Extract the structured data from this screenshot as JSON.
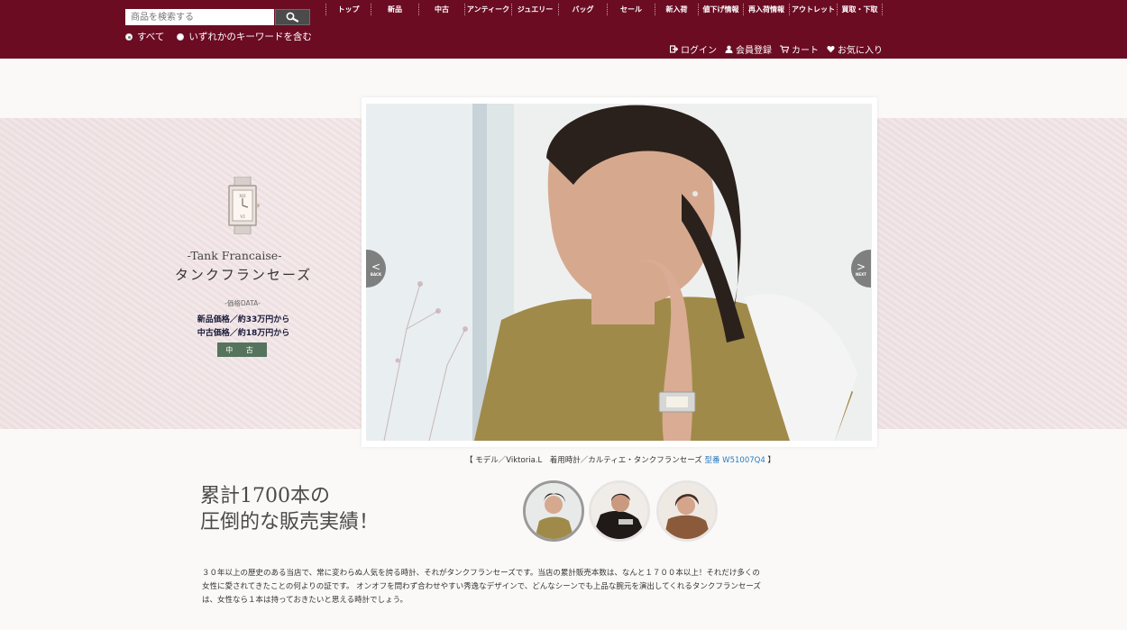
{
  "header": {
    "search_placeholder": "商品を検索する",
    "radio_all": "すべて",
    "radio_any": "いずれかのキーワードを含む",
    "nav": [
      "トップ",
      "新品",
      "中古",
      "アンティーク",
      "ジュエリー",
      "バッグ",
      "セール",
      "新入荷",
      "値下げ情報",
      "再入荷情報",
      "アウトレット",
      "買取・下取"
    ],
    "account": {
      "login": "ログイン",
      "register": "会員登録",
      "cart": "カート",
      "favorites": "お気に入り"
    }
  },
  "hero": {
    "model_en": "-Tank Francaise-",
    "model_jp": "タンクフランセーズ",
    "price_title": "-価格DATA-",
    "price_new": "新品価格／約33万円から",
    "price_used": "中古価格／約18万円から",
    "used_button": "中 古",
    "back_label": "BACK",
    "next_label": "NEXT",
    "back_chev": "<",
    "next_chev": ">"
  },
  "caption": {
    "prefix": "【 モデル／Viktoria.L　着用時計／カルティエ・タンクフランセーズ ",
    "model_no": "型番 W51007Q4",
    "suffix": " 】"
  },
  "content": {
    "headline_1": "累計1700本の",
    "headline_2": "圧倒的な販売実績！",
    "body_1": "３０年以上の歴史のある当店で、常に変わらぬ人気を誇る時計、それがタンクフランセーズです。当店の累計販売本数は、なんと１７００本以上！それだけ多くの",
    "body_2": "女性に愛されてきたことの何よりの証です。 オンオフを問わず合わせやすい秀逸なデザインで、どんなシーンでも上品な腕元を演出してくれるタンクフランセーズ",
    "body_3": "は、女性なら１本は持っておきたいと思える時計でしょう。"
  },
  "colors": {
    "header_bg": "#6b0c23",
    "used_badge": "#56735d",
    "model_no_link": "#2a7bc0"
  }
}
